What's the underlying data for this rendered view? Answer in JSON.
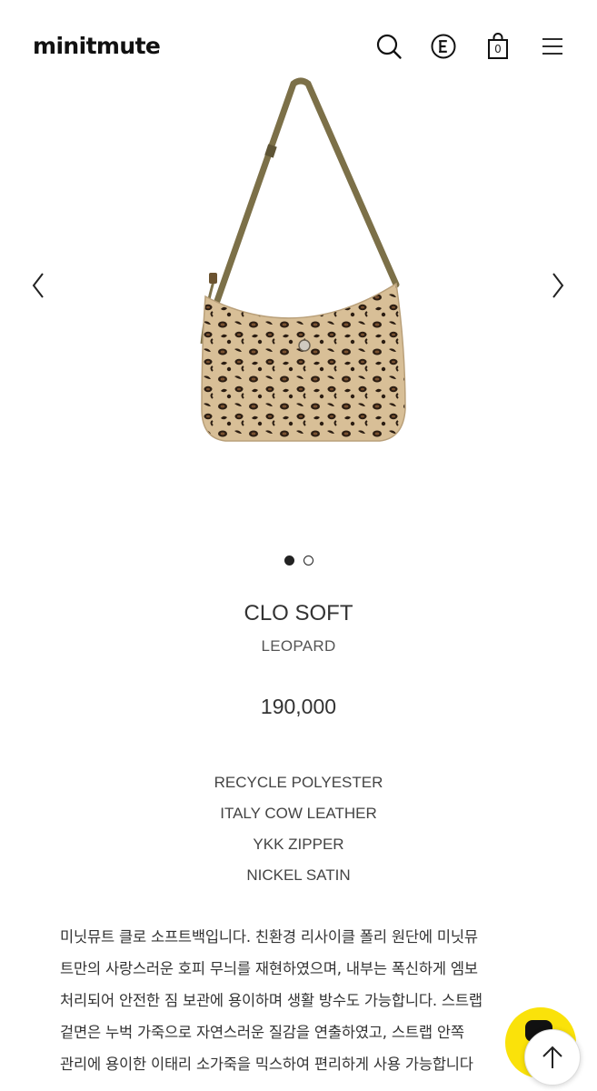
{
  "header": {
    "logo": "minitmute",
    "icons": [
      "search-icon",
      "currency-icon",
      "cart-icon",
      "menu-icon"
    ],
    "cart_count": "0"
  },
  "gallery": {
    "slide_count": 2,
    "active_slide": 1,
    "icons": [
      "chevron-left-icon",
      "chevron-right-icon"
    ]
  },
  "product": {
    "name": "CLO SOFT",
    "color": "LEOPARD",
    "price": "190,000",
    "materials": [
      "RECYCLE POLYESTER",
      "ITALY COW LEATHER",
      "YKK ZIPPER",
      "NICKEL SATIN"
    ],
    "description_lines": [
      "미닛뮤트 클로 소프트백입니다. 친환경 리사이클 폴리 원단에 미닛뮤",
      "트만의 사랑스러운 호피 무늬를 재현하였으며, 내부는 폭신하게 엠보",
      "처리되어 안전한 짐 보관에 용이하며 생활 방수도 가능합니다. 스트랩",
      "겉면은 누벅 가죽으로 자연스러운 질감을 연출하였고, 스트랩 안쪽",
      "관리에 용이한 이태리 소가죽을 믹스하여 편리하게 사용 가능합니다"
    ]
  },
  "floating": {
    "icons": [
      "chat-icon",
      "arrow-up-icon"
    ],
    "accent": "#fae20a"
  }
}
